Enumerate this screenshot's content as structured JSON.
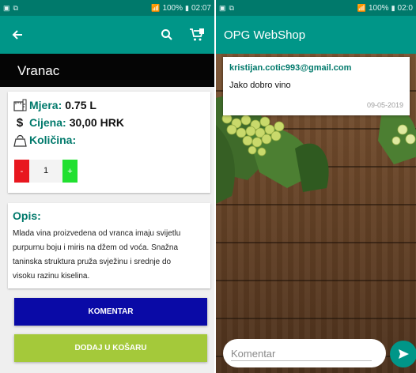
{
  "status_left": {
    "time": "02:07",
    "battery": "100%"
  },
  "status_right": {
    "time": "02:0",
    "battery": "100%"
  },
  "product": {
    "name": "Vranac",
    "measure_label": "Mjera:",
    "measure_value": "0.75 L",
    "price_label": "Cijena:",
    "price_value": "30,00 HRK",
    "quantity_label": "Količina:",
    "quantity_value": "1",
    "minus_label": "-",
    "plus_label": "+",
    "description_title": "Opis:",
    "description_lines": [
      "Mlada vina proizvedena od vranca imaju svijetlu",
      "purpurnu boju i miris na džem od voća. Snažna",
      "taninska struktura pruža svježinu i srednje do",
      "visoku razinu kiselina."
    ]
  },
  "buttons": {
    "comment": "KOMENTAR",
    "add_to_cart": "DODAJ U KOŠARU"
  },
  "shop": {
    "title": "OPG WebShop"
  },
  "comment": {
    "email": "kristijan.cotic993@gmail.com",
    "text": "Jako dobro vino",
    "date": "09-05-2019"
  },
  "comment_input": {
    "placeholder": "Komentar"
  },
  "icons": {
    "back": "arrow-left-icon",
    "search": "search-icon",
    "cart": "cart-icon",
    "measure": "ruler-icon",
    "price": "dollar-icon",
    "quantity": "weight-icon",
    "send": "send-icon"
  },
  "colors": {
    "primary": "#009688",
    "primary_dark": "#00796b",
    "comment_button": "#0a0aa6",
    "cart_button": "#a4c93a",
    "minus": "#e8171f",
    "plus": "#21e030"
  }
}
